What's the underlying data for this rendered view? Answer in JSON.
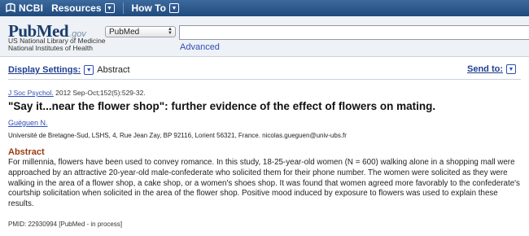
{
  "ncbi_bar": {
    "logo_text": "NCBI",
    "menu": [
      {
        "label": "Resources",
        "icon": "caret-down-icon"
      },
      {
        "label": "How To",
        "icon": "caret-down-icon"
      }
    ]
  },
  "header": {
    "logo_pub": "Pub",
    "logo_med": "Med",
    "logo_gov": ".gov",
    "nlm_line1": "US National Library of Medicine",
    "nlm_line2": "National Institutes of Health",
    "database_selected": "PubMed",
    "search_value": "",
    "advanced_label": "Advanced"
  },
  "display_settings": {
    "label": "Display Settings:",
    "value": "Abstract",
    "send_to_label": "Send to:"
  },
  "article": {
    "journal": "J Soc Psychol.",
    "citation_details": " 2012 Sep-Oct;152(5):529-32.",
    "title": "\"Say it...near the flower shop\": further evidence of the effect of flowers on mating.",
    "author": "Guéguen N.",
    "affiliation": "Université de Bretagne-Sud, LSHS, 4, Rue Jean Zay, BP 92116, Lorient 56321, France. nicolas.gueguen@univ-ubs.fr",
    "abstract_heading": "Abstract",
    "abstract_text": "For millennia, flowers have been used to convey romance. In this study, 18-25-year-old women (N = 600) walking alone in a shopping mall were approached by an attractive 20-year-old male-confederate who solicited them for their phone number. The women were solicited as they were walking in the area of a flower shop, a cake shop, or a women's shoes shop. It was found that women agreed more favorably to the confederate's courtship solicitation when solicited in the area of the flower shop. Positive mood induced by exposure to flowers was used to explain these results.",
    "pmid_line": "PMID: 22930994 [PubMed - in process]"
  },
  "colors": {
    "top_bar": "#2b5688",
    "link": "#2e4fb8",
    "abstract_heading": "#9a3a14",
    "header_bg": "#eef1f5"
  }
}
